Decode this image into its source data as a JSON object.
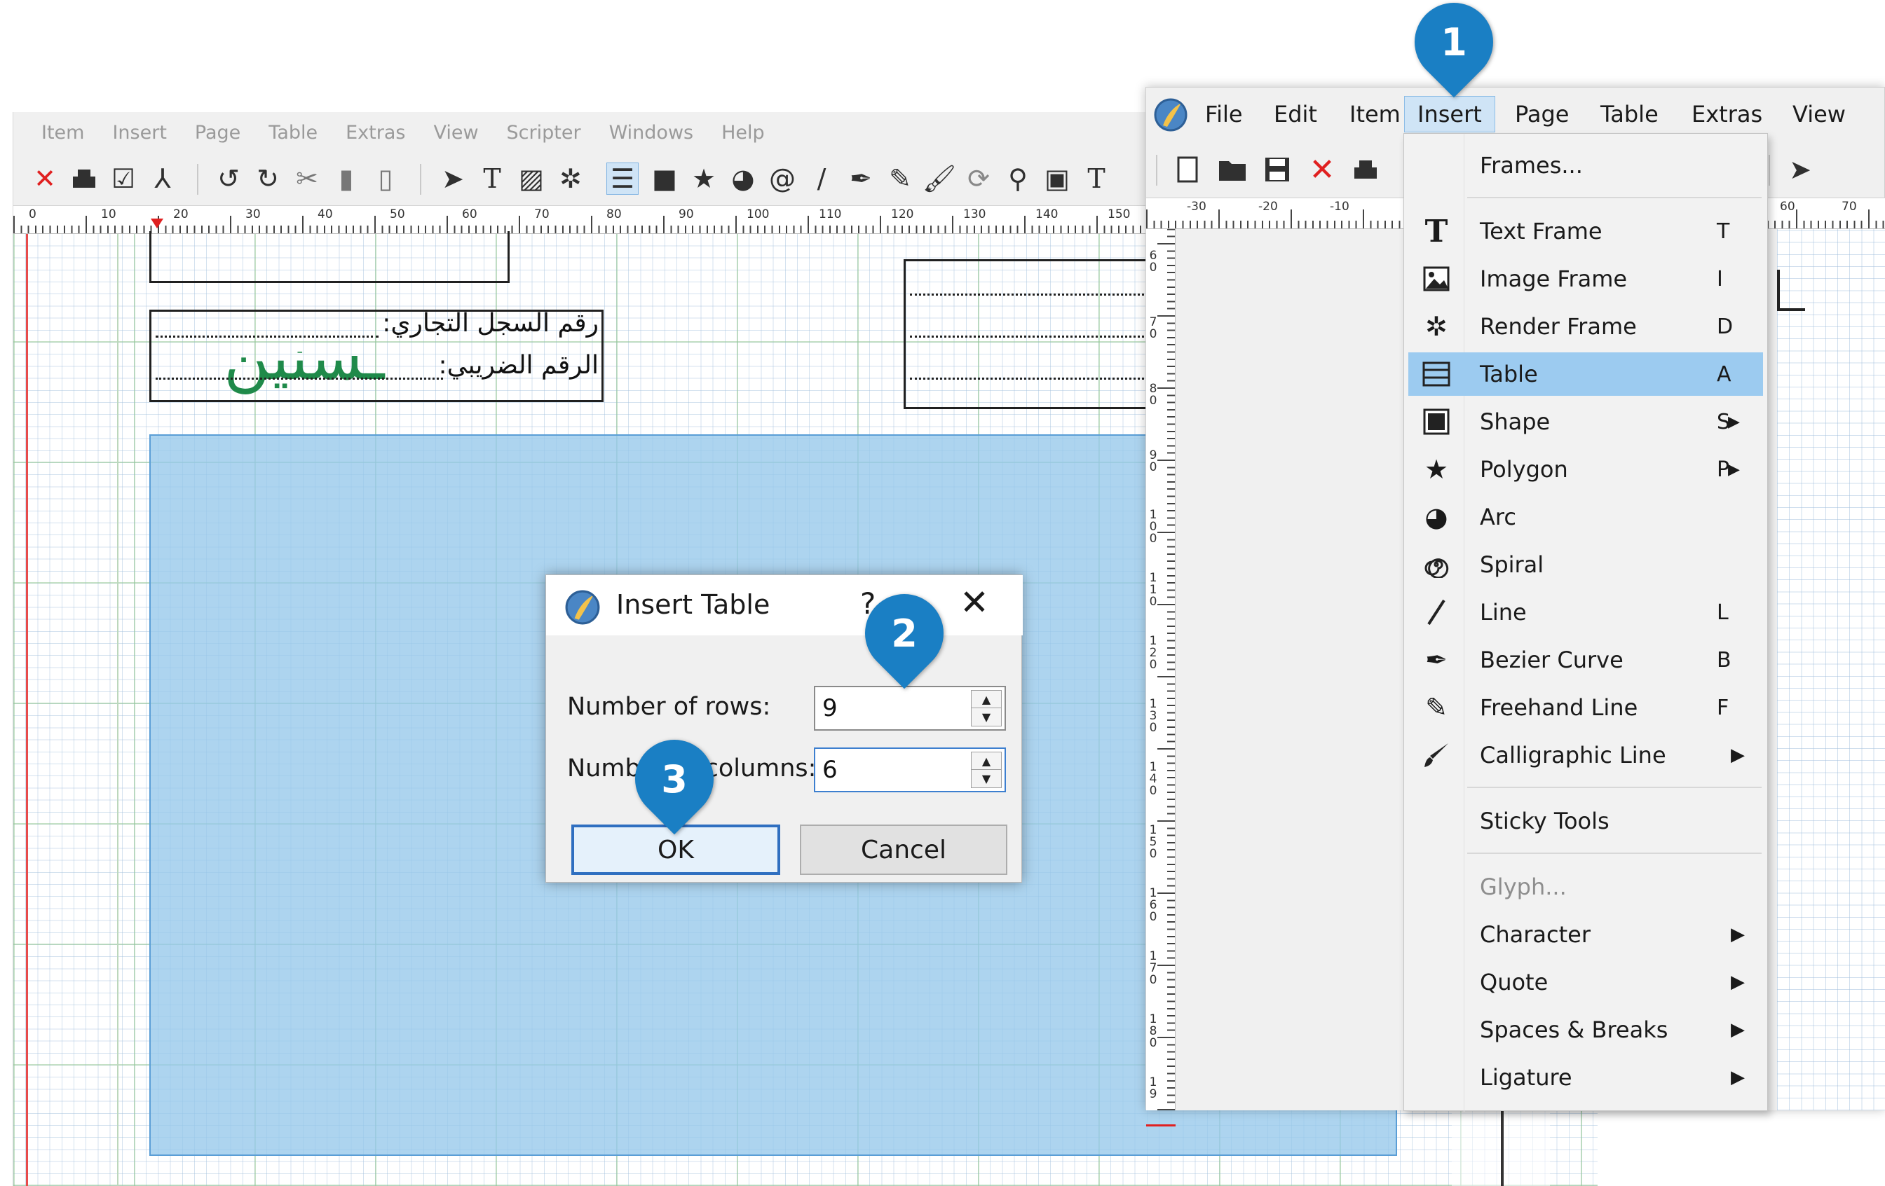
{
  "background_window": {
    "menu": [
      "Item",
      "Insert",
      "Page",
      "Table",
      "Extras",
      "View",
      "Scripter",
      "Windows",
      "Help"
    ],
    "ruler_labels": [
      "0",
      "10",
      "20",
      "30",
      "40",
      "50",
      "60",
      "70",
      "80",
      "90",
      "100",
      "110",
      "120",
      "130",
      "140",
      "150"
    ],
    "document": {
      "commercial_register_label": "رقم السجل التجاري:",
      "tax_number_label": "الرقم الضريبي:"
    }
  },
  "right_window": {
    "menu": [
      "File",
      "Edit",
      "Item",
      "Insert",
      "Page",
      "Table",
      "Extras",
      "View"
    ],
    "active_menu": "Insert",
    "ruler_labels": [
      "-30",
      "-20",
      "-10",
      "60",
      "70"
    ],
    "vertical_ruler_labels": [
      "6 0",
      "7 0",
      "8 0",
      "9 0",
      "1 0 0",
      "1 1 0",
      "1 2 0",
      "1 3 0",
      "1 4 0",
      "1 5 0",
      "1 6 0",
      "1 7 0",
      "1 8 0",
      "1 9"
    ]
  },
  "insert_menu": {
    "items": [
      {
        "label": "Frames...",
        "shortcut": "",
        "icon": "none"
      },
      {
        "label": "Text Frame",
        "shortcut": "T",
        "icon": "text-frame-icon"
      },
      {
        "label": "Image Frame",
        "shortcut": "I",
        "icon": "image-frame-icon"
      },
      {
        "label": "Render Frame",
        "shortcut": "D",
        "icon": "render-frame-icon"
      },
      {
        "label": "Table",
        "shortcut": "A",
        "icon": "table-icon",
        "highlighted": true
      },
      {
        "label": "Shape",
        "shortcut": "S",
        "icon": "shape-icon",
        "submenu": true
      },
      {
        "label": "Polygon",
        "shortcut": "P",
        "icon": "polygon-icon",
        "submenu": true
      },
      {
        "label": "Arc",
        "shortcut": "",
        "icon": "arc-icon"
      },
      {
        "label": "Spiral",
        "shortcut": "",
        "icon": "spiral-icon"
      },
      {
        "label": "Line",
        "shortcut": "L",
        "icon": "line-icon"
      },
      {
        "label": "Bezier Curve",
        "shortcut": "B",
        "icon": "bezier-curve-icon"
      },
      {
        "label": "Freehand Line",
        "shortcut": "F",
        "icon": "freehand-line-icon"
      },
      {
        "label": "Calligraphic Line",
        "shortcut": "",
        "icon": "calligraphic-line-icon",
        "submenu": true
      },
      {
        "label": "Sticky Tools",
        "shortcut": "",
        "icon": "none"
      },
      {
        "label": "Glyph...",
        "shortcut": "",
        "icon": "none",
        "disabled": true
      },
      {
        "label": "Character",
        "shortcut": "",
        "icon": "none",
        "submenu": true
      },
      {
        "label": "Quote",
        "shortcut": "",
        "icon": "none",
        "submenu": true
      },
      {
        "label": "Spaces & Breaks",
        "shortcut": "",
        "icon": "none",
        "submenu": true
      },
      {
        "label": "Ligature",
        "shortcut": "",
        "icon": "none",
        "submenu": true
      }
    ]
  },
  "dialog": {
    "title": "Insert Table",
    "help": "?",
    "rows_label": "Number of rows:",
    "rows_value": "9",
    "columns_label": "Number of columns:",
    "columns_value": "6",
    "ok_label": "OK",
    "cancel_label": "Cancel"
  },
  "callouts": [
    "1",
    "2",
    "3"
  ],
  "colors": {
    "callout": "#1a7fc4",
    "menu_highlight": "#9ccbf0",
    "selection_blue": "#96c8eb"
  }
}
